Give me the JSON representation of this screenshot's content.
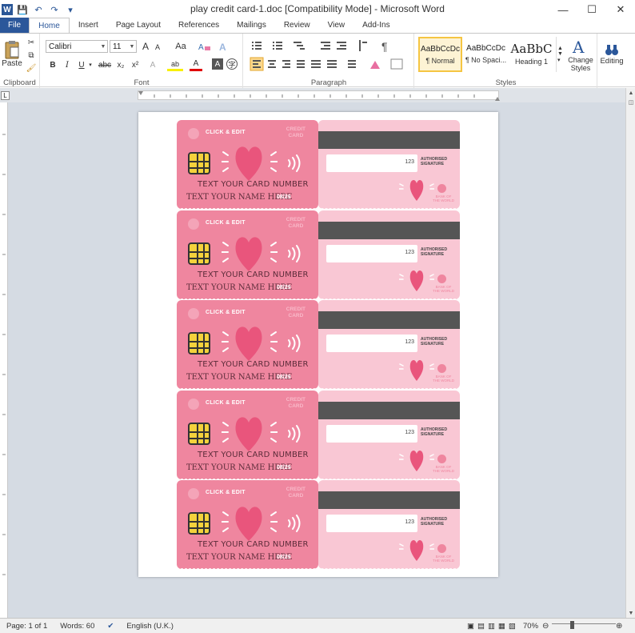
{
  "window": {
    "title": "play credit card-1.doc [Compatibility Mode]  -  Microsoft Word",
    "minimize": "—",
    "maximize": "☐",
    "close": "✕"
  },
  "qat": {
    "logo": "W",
    "save": "💾",
    "undo": "↶",
    "redo": "↷",
    "customize": "▾"
  },
  "tabs": [
    "File",
    "Home",
    "Insert",
    "Page Layout",
    "References",
    "Mailings",
    "Review",
    "View",
    "Add-Ins"
  ],
  "ribbon": {
    "clipboard": {
      "label": "Clipboard",
      "paste": "Paste"
    },
    "font": {
      "label": "Font",
      "name": "Calibri",
      "size": "11",
      "bold": "B",
      "italic": "I",
      "underline": "U",
      "strike": "abc",
      "subscript": "x₂",
      "superscript": "x²",
      "grow": "A",
      "shrink": "A",
      "case": "Aa",
      "clear": "⌫",
      "highlight": "ab",
      "color": "A"
    },
    "paragraph": {
      "label": "Paragraph"
    },
    "styles": {
      "label": "Styles",
      "items": [
        {
          "preview": "AaBbCcDc",
          "name": "¶ Normal"
        },
        {
          "preview": "AaBbCcDc",
          "name": "¶ No Spaci..."
        },
        {
          "preview": "AaBbC",
          "name": "Heading 1"
        }
      ],
      "change": "Change Styles",
      "change_line1": "Change",
      "change_line2": "Styles"
    },
    "editing": {
      "label": "Editing"
    }
  },
  "card": {
    "click_edit": "CLICK & EDIT",
    "credit_line1": "CREDIT",
    "credit_line2": "CARD",
    "number": "TEXT YOUR CARD NUMBER",
    "name": "TEXT YOUR NAME HERE",
    "expiry": "08/29",
    "cvv": "123",
    "auth_line1": "AUTHORISED",
    "auth_line2": "SIGNATURE",
    "slogan_line1": "BANK OF",
    "slogan_line2": "THE WORLD",
    "count": 5
  },
  "colors": {
    "front": "#ef869f",
    "back": "#f9c7d4",
    "heart": "#e9557c",
    "stripe": "#555555",
    "chip": "#f4d23c"
  },
  "status": {
    "page": "Page: 1 of 1",
    "words": "Words: 60",
    "language": "English (U.K.)",
    "zoom": "70%",
    "zoom_level": 0.7
  }
}
